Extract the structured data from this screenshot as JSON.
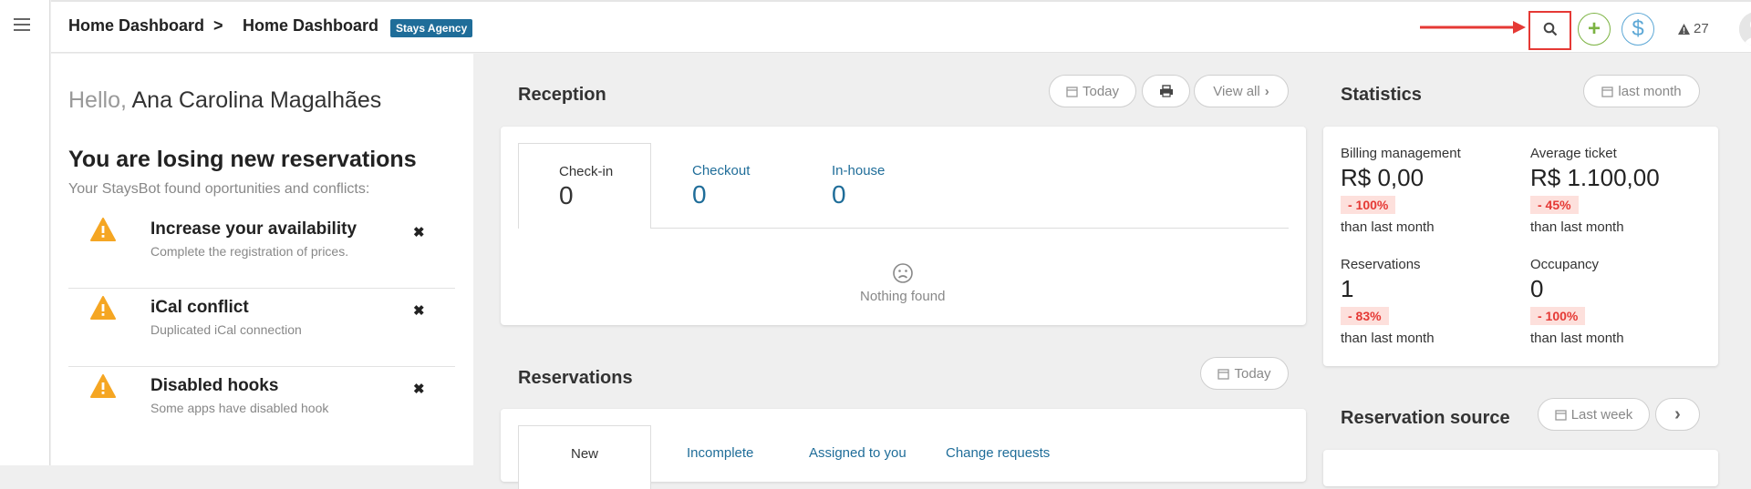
{
  "topbar": {
    "breadcrumb": [
      "Home Dashboard",
      "Home Dashboard"
    ],
    "separator": ">",
    "agency_badge": "Stays Agency",
    "alert_count": "27"
  },
  "greeting": {
    "hello": "Hello,",
    "name": "Ana Carolina Magalhães"
  },
  "losing": {
    "title": "You are losing new reservations",
    "subtitle": "Your StaysBot found oportunities and conflicts:",
    "items": [
      {
        "title": "Increase your availability",
        "subtitle": "Complete the registration of prices."
      },
      {
        "title": "iCal conflict",
        "subtitle": "Duplicated iCal connection"
      },
      {
        "title": "Disabled hooks",
        "subtitle": "Some apps have disabled hook"
      }
    ]
  },
  "reception": {
    "title": "Reception",
    "today_label": "Today",
    "view_all_label": "View all",
    "tabs": [
      {
        "label": "Check-in",
        "value": "0"
      },
      {
        "label": "Checkout",
        "value": "0"
      },
      {
        "label": "In-house",
        "value": "0"
      }
    ],
    "empty_text": "Nothing found"
  },
  "reservations": {
    "title": "Reservations",
    "today_label": "Today",
    "tabs": [
      "New",
      "Incomplete",
      "Assigned to you",
      "Change requests"
    ]
  },
  "statistics": {
    "title": "Statistics",
    "period_label": "last month",
    "items": [
      {
        "label": "Billing management",
        "value": "R$ 0,00",
        "change": "- 100%",
        "than": "than last month"
      },
      {
        "label": "Average ticket",
        "value": "R$ 1.100,00",
        "change": "- 45%",
        "than": "than last month"
      },
      {
        "label": "Reservations",
        "value": "1",
        "change": "- 83%",
        "than": "than last month"
      },
      {
        "label": "Occupancy",
        "value": "0",
        "change": "- 100%",
        "than": "than last month"
      }
    ]
  },
  "reservation_source": {
    "title": "Reservation source",
    "period_label": "Last week"
  },
  "colors": {
    "accent": "#1f6d99",
    "warning": "#f5a623",
    "negative": "#e53935",
    "green": "#7cb342"
  }
}
